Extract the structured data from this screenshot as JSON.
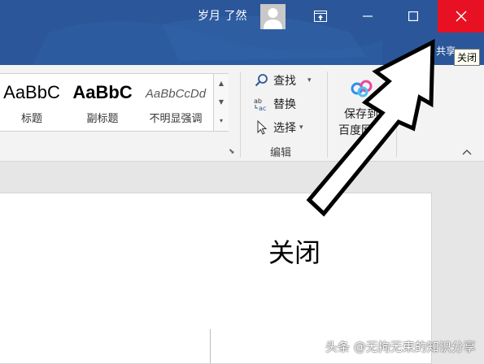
{
  "titlebar": {
    "user_name": "岁月 了然",
    "share": "共享",
    "close_tooltip": "关闭"
  },
  "ribbon": {
    "styles": [
      {
        "sample": "AaBbC",
        "name": "标题"
      },
      {
        "sample": "AaBbC",
        "name": "副标题"
      },
      {
        "sample": "AaBbCcDd",
        "name": "不明显强调"
      }
    ],
    "editing": {
      "find": "查找",
      "replace": "替换",
      "select": "选择",
      "group_label": "编辑"
    },
    "save": {
      "line1": "保存到",
      "line2": "百度网盘",
      "group_label": "保存"
    }
  },
  "document": {
    "body_text": "关闭"
  },
  "watermark": "头条 @无拘无束的知识分享",
  "colors": {
    "titlebar": "#2b579a",
    "close_hover": "#e81123",
    "ribbon": "#f3f3f3",
    "workspace": "#e6e6e6"
  }
}
